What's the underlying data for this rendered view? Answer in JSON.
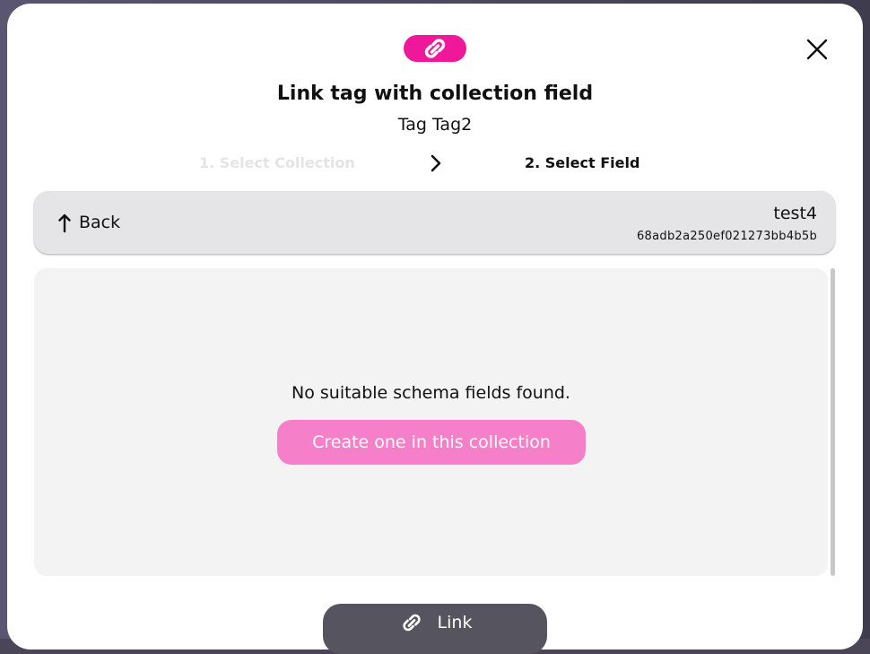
{
  "dialog": {
    "title": "Link tag with collection field",
    "subtitle": "Tag Tag2",
    "brand_icon": "link-icon",
    "close_icon": "close-icon"
  },
  "steps": [
    {
      "label": "1. Select Collection",
      "state": "inactive"
    },
    {
      "label": "2. Select Field",
      "state": "active"
    }
  ],
  "collection_header": {
    "back_label": "Back",
    "back_icon": "arrow-up-back-icon",
    "collection_name": "test4",
    "collection_id": "68adb2a250ef021273bb4b5b"
  },
  "empty_state": {
    "message": "No suitable schema fields found.",
    "create_label": "Create one in this collection"
  },
  "footer": {
    "link_label": "Link",
    "link_icon": "link-icon"
  },
  "colors": {
    "brand": "#f0189a",
    "create_button": "#f57fc8",
    "link_button": "#56545e",
    "header_bar": "#e5e5e7",
    "content_bg": "#f3f3f3"
  }
}
